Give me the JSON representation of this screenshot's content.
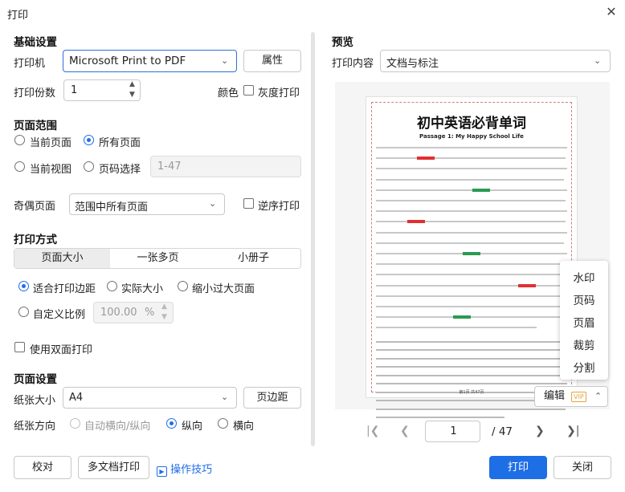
{
  "window": {
    "title": "打印",
    "close": "✕"
  },
  "basic": {
    "heading": "基础设置",
    "printer_label": "打印机",
    "printer_value": "Microsoft Print to PDF",
    "properties_button": "属性",
    "copies_label": "打印份数",
    "copies_value": "1",
    "color_label": "颜色",
    "grayscale_label": "灰度打印"
  },
  "range": {
    "heading": "页面范围",
    "current_page": "当前页面",
    "all_pages": "所有页面",
    "current_view": "当前视图",
    "page_select": "页码选择",
    "page_select_placeholder": "1-47"
  },
  "odd_even": {
    "label": "奇偶页面",
    "value": "范围中所有页面",
    "reverse_label": "逆序打印"
  },
  "method": {
    "heading": "打印方式",
    "tabs": [
      "页面大小",
      "一张多页",
      "小册子"
    ],
    "fit_margin": "适合打印边距",
    "actual_size": "实际大小",
    "shrink_large": "缩小过大页面",
    "custom_scale": "自定义比例",
    "scale_value": "100.00",
    "scale_unit": "%",
    "duplex_label": "使用双面打印"
  },
  "page_setup": {
    "heading": "页面设置",
    "paper_size_label": "纸张大小",
    "paper_size_value": "A4",
    "margins_button": "页边距",
    "orientation_label": "纸张方向",
    "auto_orientation": "自动横向/纵向",
    "portrait": "纵向",
    "landscape": "横向"
  },
  "footer": {
    "proof_button": "校对",
    "multi_doc_button": "多文档打印",
    "tips_link": "操作技巧",
    "print_button": "打印",
    "close_button": "关闭"
  },
  "preview": {
    "heading": "预览",
    "content_label": "打印内容",
    "content_value": "文档与标注",
    "doc_title": "初中英语必背单词",
    "doc_subtitle": "Passage 1: My Happy School Life",
    "doc_footer": "第1页 共47页"
  },
  "edit_menu": {
    "button": "编辑",
    "vip_badge": "VIP",
    "items": [
      "水印",
      "页码",
      "页眉",
      "裁剪",
      "分割"
    ]
  },
  "pager": {
    "current": "1",
    "total": "/ 47"
  },
  "colors": {
    "accent": "#1e6ee6",
    "doc_highlight_red": "#e03030",
    "doc_highlight_green": "#2a9a50"
  }
}
